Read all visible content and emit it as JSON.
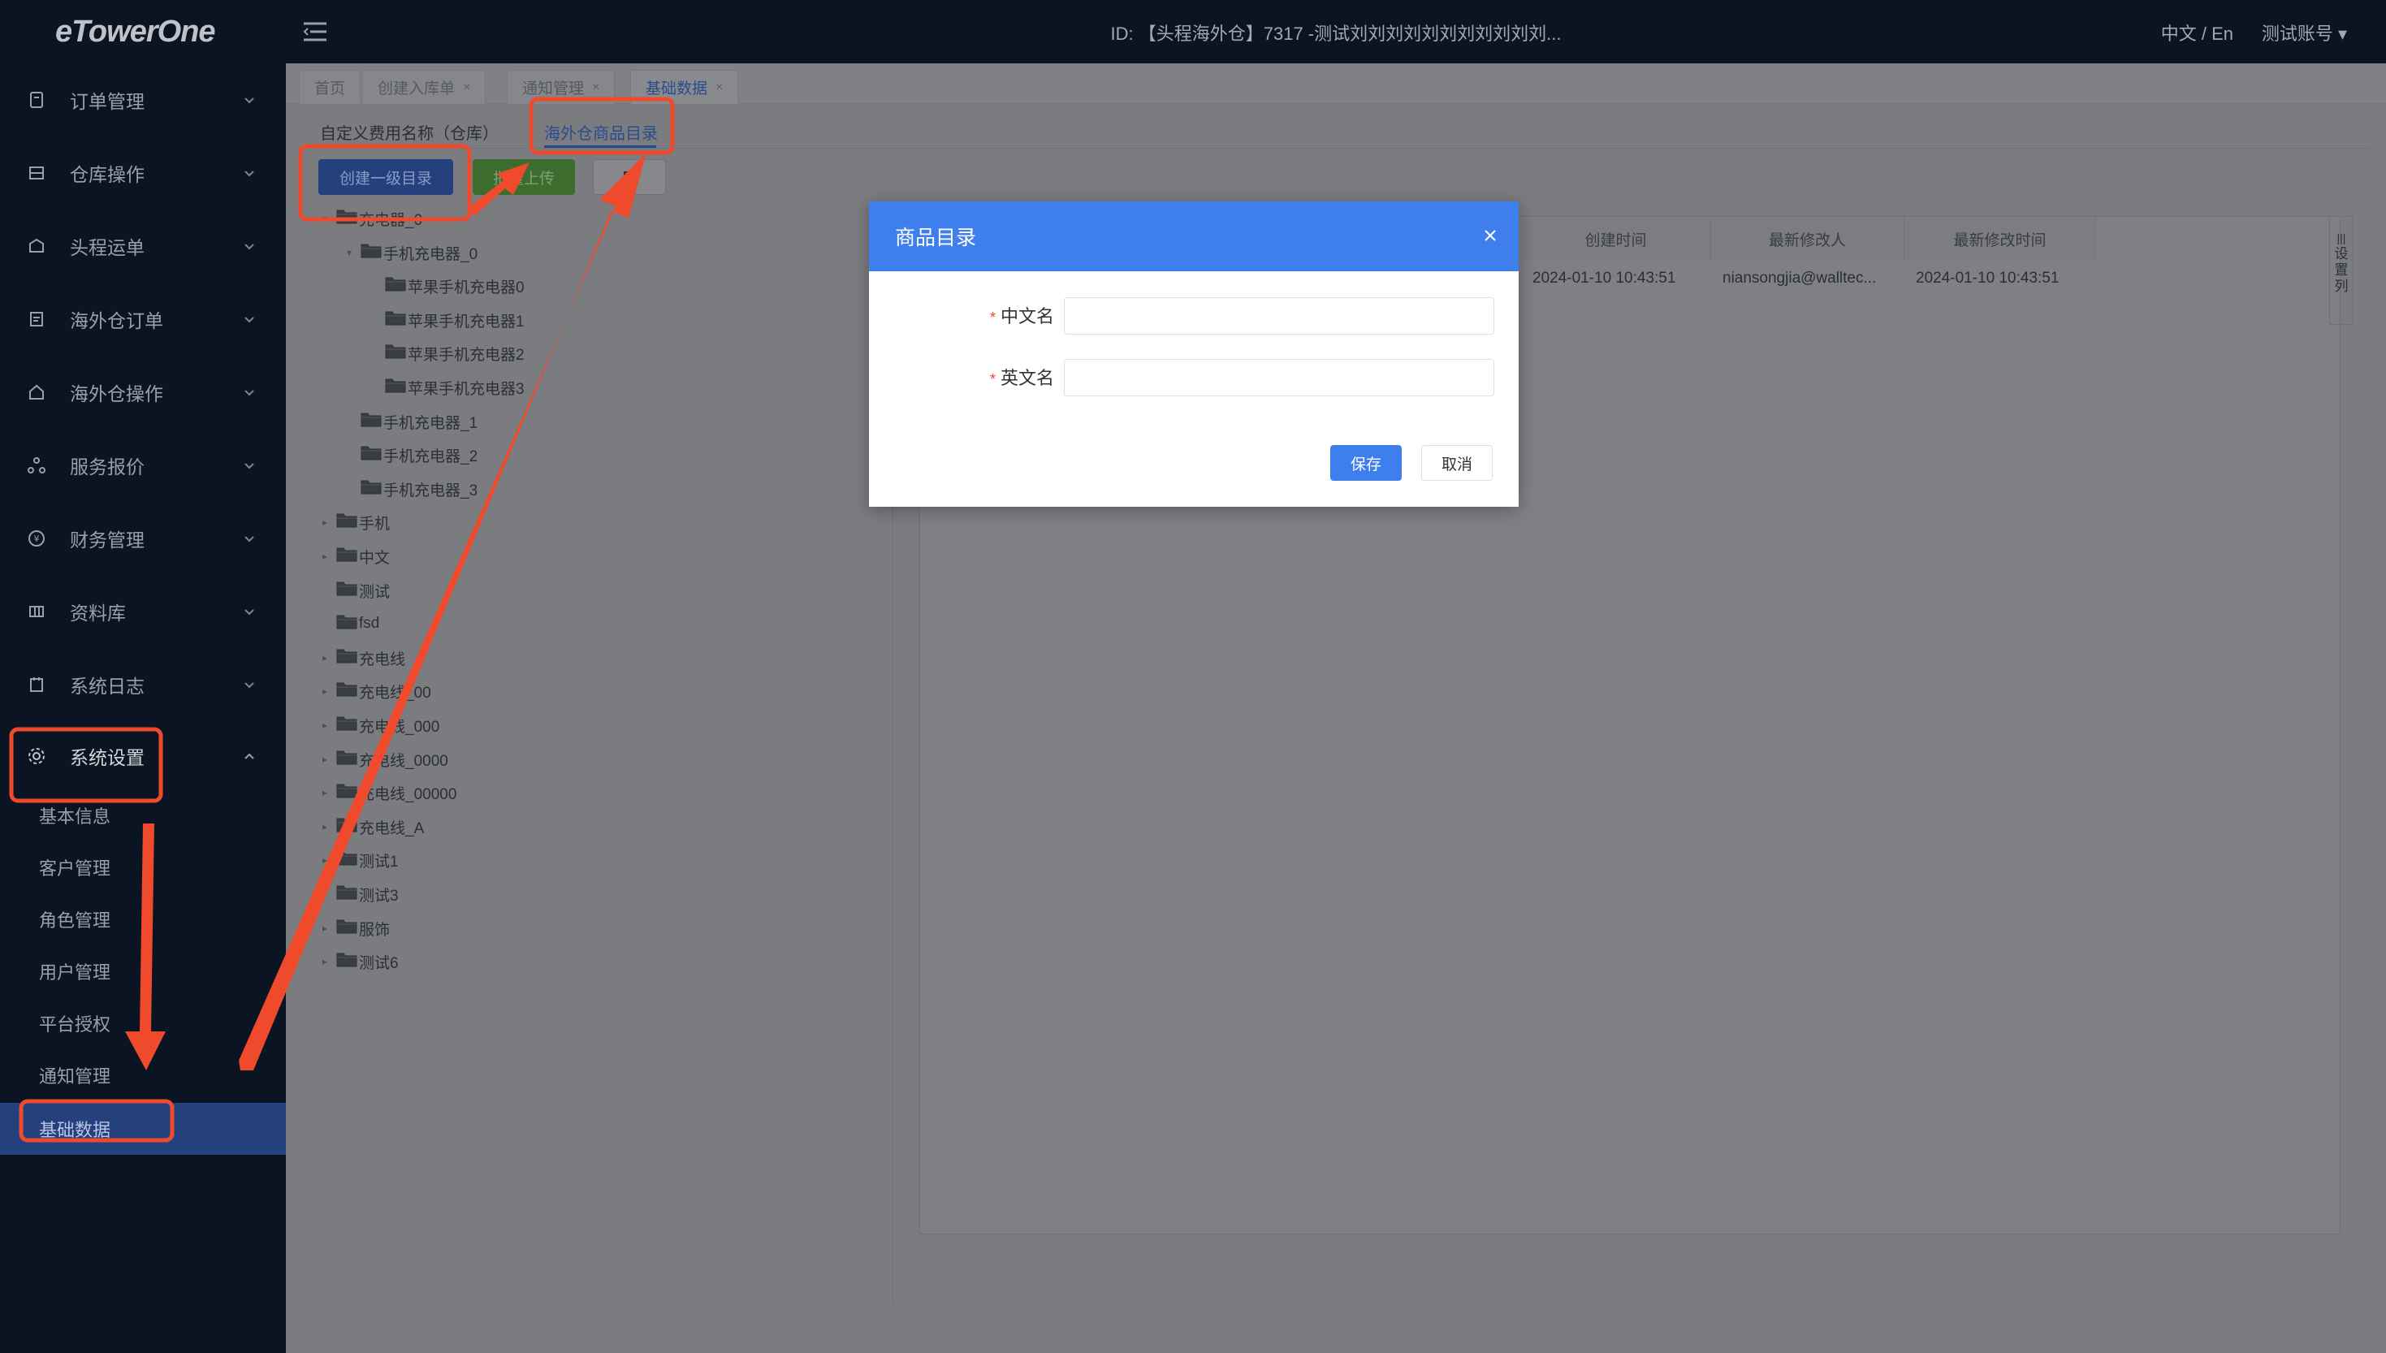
{
  "app": {
    "logo": "eTowerOne",
    "header_title": "ID: 【头程海外仓】7317 -测试刘刘刘刘刘刘刘刘刘刘刘...",
    "language": "中文 / En",
    "account": "测试账号 ▾"
  },
  "sidebar": {
    "items": [
      {
        "label": "订单管理",
        "icon": "order-icon"
      },
      {
        "label": "仓库操作",
        "icon": "warehouse-icon"
      },
      {
        "label": "头程运单",
        "icon": "shipment-icon"
      },
      {
        "label": "海外仓订单",
        "icon": "overseas-order-icon"
      },
      {
        "label": "海外仓操作",
        "icon": "overseas-operation-icon"
      },
      {
        "label": "服务报价",
        "icon": "quote-icon"
      },
      {
        "label": "财务管理",
        "icon": "finance-icon"
      },
      {
        "label": "资料库",
        "icon": "library-icon"
      },
      {
        "label": "系统日志",
        "icon": "log-icon"
      },
      {
        "label": "系统设置",
        "icon": "gear-icon"
      }
    ],
    "sub_items": [
      "基本信息",
      "客户管理",
      "角色管理",
      "用户管理",
      "平台授权",
      "通知管理",
      "基础数据"
    ]
  },
  "tabs": [
    {
      "label": "首页",
      "closable": false
    },
    {
      "label": "创建入库单",
      "closable": true
    },
    {
      "label": "通知管理",
      "closable": true
    },
    {
      "label": "基础数据",
      "closable": true
    }
  ],
  "subtabs": [
    "自定义费用名称（仓库）",
    "海外仓商品目录"
  ],
  "toolbar": {
    "create_label": "创建一级目录",
    "upload_label": "批量上传"
  },
  "tree": [
    {
      "label": "充电器_0",
      "depth": 0,
      "arrow": "▾"
    },
    {
      "label": "手机充电器_0",
      "depth": 1,
      "arrow": "▾"
    },
    {
      "label": "苹果手机充电器0",
      "depth": 2,
      "arrow": ""
    },
    {
      "label": "苹果手机充电器1",
      "depth": 2,
      "arrow": ""
    },
    {
      "label": "苹果手机充电器2",
      "depth": 2,
      "arrow": ""
    },
    {
      "label": "苹果手机充电器3",
      "depth": 2,
      "arrow": ""
    },
    {
      "label": "手机充电器_1",
      "depth": 1,
      "arrow": ""
    },
    {
      "label": "手机充电器_2",
      "depth": 1,
      "arrow": ""
    },
    {
      "label": "手机充电器_3",
      "depth": 1,
      "arrow": ""
    },
    {
      "label": "手机",
      "depth": 0,
      "arrow": "▸"
    },
    {
      "label": "中文",
      "depth": 0,
      "arrow": "▸"
    },
    {
      "label": "测试",
      "depth": 0,
      "arrow": ""
    },
    {
      "label": "fsd",
      "depth": 0,
      "arrow": ""
    },
    {
      "label": "充电线",
      "depth": 0,
      "arrow": "▸"
    },
    {
      "label": "充电线_00",
      "depth": 0,
      "arrow": "▸"
    },
    {
      "label": "充电线_000",
      "depth": 0,
      "arrow": "▸"
    },
    {
      "label": "充电线_0000",
      "depth": 0,
      "arrow": "▸"
    },
    {
      "label": "充电线_00000",
      "depth": 0,
      "arrow": "▸"
    },
    {
      "label": "充电线_A",
      "depth": 0,
      "arrow": "▸"
    },
    {
      "label": "测试1",
      "depth": 0,
      "arrow": "▸"
    },
    {
      "label": "测试3",
      "depth": 0,
      "arrow": "▸"
    },
    {
      "label": "服饰",
      "depth": 0,
      "arrow": "▸"
    },
    {
      "label": "测试6",
      "depth": 0,
      "arrow": "▸"
    }
  ],
  "table": {
    "headers": [
      "创建时间",
      "最新修改人",
      "最新修改时间"
    ],
    "row": [
      "2024-01-10 10:43:51",
      "niansongjia@walltec...",
      "2024-01-10 10:43:51"
    ],
    "column_settings": [
      "设",
      "置",
      "列"
    ]
  },
  "modal": {
    "title": "商品目录",
    "field_cn_label": "中文名",
    "field_en_label": "英文名",
    "required_mark": "*",
    "field_cn_value": "",
    "field_en_value": "",
    "save_label": "保存",
    "cancel_label": "取消"
  },
  "colors": {
    "primary": "#3f7fed",
    "annotation_red": "#f04a2c",
    "sidebar_bg": "#0b1422"
  }
}
